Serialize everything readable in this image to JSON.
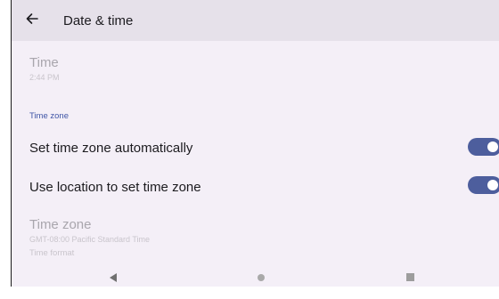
{
  "appbar": {
    "title": "Date & time",
    "back_icon": "arrow-left-icon"
  },
  "time_item": {
    "title": "Time",
    "value": "2:44 PM"
  },
  "section_time_zone": {
    "label": "Time zone"
  },
  "auto_time_zone": {
    "label": "Set time zone automatically",
    "enabled": true
  },
  "location_time_zone": {
    "label": "Use location to set time zone",
    "enabled": true
  },
  "time_zone_item": {
    "title": "Time zone",
    "value": "GMT-08:00 Pacific Standard Time"
  },
  "section_time_format": {
    "label": "Time format"
  },
  "colors": {
    "accent": "#4d5e9d",
    "section_header": "#3f55a6",
    "background": "#f4eff7",
    "appbar": "#e6e1ea"
  },
  "navbar": {
    "back_icon": "triangle-back-icon",
    "home_icon": "circle-home-icon",
    "recents_icon": "square-recents-icon"
  }
}
